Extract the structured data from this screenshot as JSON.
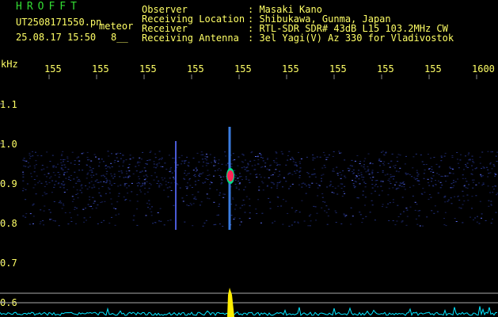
{
  "header": {
    "brand": "HROFFT",
    "filename": "UT2508171550.pn",
    "meteor_label": "meteor",
    "datetime": "25.08.17 15:50",
    "count_label": "8__",
    "fields": [
      {
        "label": "Observer",
        "value": ": Masaki Kano"
      },
      {
        "label": "Receiving Location",
        "value": ": Shibukawa, Gunma, Japan"
      },
      {
        "label": "Receiver",
        "value": ": RTL-SDR SDR# 43dB L15 103.2MHz CW"
      },
      {
        "label": "Receiving Antenna",
        "value": ": 3el Yagi(V) Az 330 for Vladivostok"
      }
    ]
  },
  "axis": {
    "unit": "kHz",
    "time_ticks": [
      "155",
      "155",
      "155",
      "155",
      "155",
      "155",
      "155",
      "155",
      "155",
      "1600"
    ],
    "freq_ticks": [
      "1.1",
      "1.0",
      "0.9",
      "0.8",
      "0.7",
      "0.6"
    ]
  },
  "colors": {
    "text": "#ffff66",
    "brand": "#33dd33",
    "background": "#000000",
    "noise": "#2b3aa8",
    "echo_hot": "#ff2255",
    "signal_trace": "#00e5ff",
    "peak": "#ffee00"
  }
}
